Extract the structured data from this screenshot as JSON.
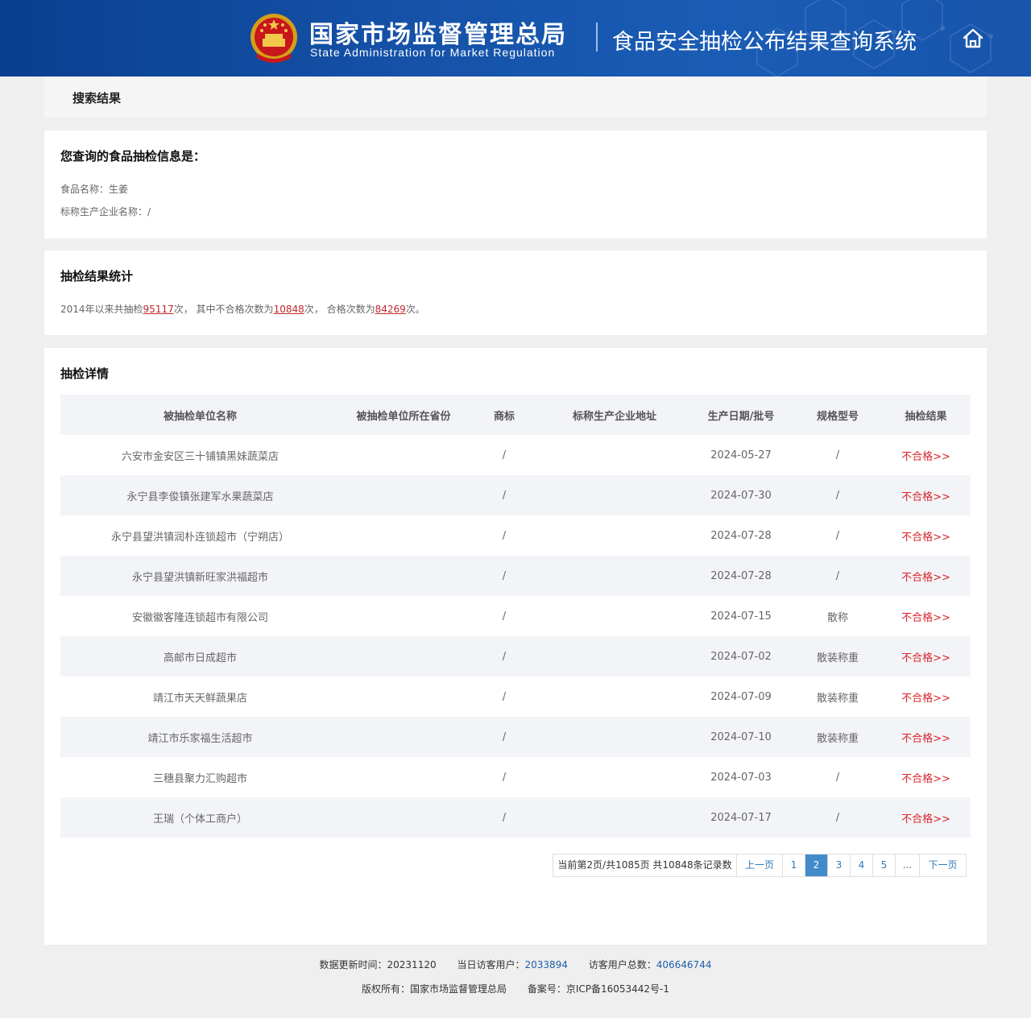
{
  "header": {
    "brand_cn": "国家市场监督管理总局",
    "brand_en": "State Administration  for  Market Regulation",
    "system_title": "食品安全抽检公布结果查询系统",
    "home_icon": "home-icon",
    "bg_color": "#1552a8"
  },
  "crumb": {
    "title": "搜索结果"
  },
  "query": {
    "title": "您查询的食品抽检信息是：",
    "food_name": "食品名称：生姜",
    "producer": "标称生产企业名称：/"
  },
  "stats": {
    "title": "抽检结果统计",
    "prefix": "2014年以来共抽检",
    "total": "95117",
    "mid1": "次， 其中不合格次数为",
    "failed": "10848",
    "mid2": "次， 合格次数为",
    "passed": "84269",
    "suffix": "次。",
    "accent_color": "#c0282d"
  },
  "detail": {
    "title": "抽检详情",
    "columns": [
      "被抽检单位名称",
      "被抽检单位所在省份",
      "商标",
      "标称生产企业地址",
      "生产日期/批号",
      "规格型号",
      "抽检结果"
    ],
    "rows": [
      {
        "unit": "六安市金安区三十铺镇黑妹蔬菜店",
        "province": "",
        "brand": "/",
        "address": "",
        "date": "2024-05-27",
        "spec": "/",
        "result": "不合格>>"
      },
      {
        "unit": "永宁县李俊镇张建军水果蔬菜店",
        "province": "",
        "brand": "/",
        "address": "",
        "date": "2024-07-30",
        "spec": "/",
        "result": "不合格>>"
      },
      {
        "unit": "永宁县望洪镇润朴连锁超市（宁朔店）",
        "province": "",
        "brand": "/",
        "address": "",
        "date": "2024-07-28",
        "spec": "/",
        "result": "不合格>>"
      },
      {
        "unit": "永宁县望洪镇新旺家洪福超市",
        "province": "",
        "brand": "/",
        "address": "",
        "date": "2024-07-28",
        "spec": "/",
        "result": "不合格>>"
      },
      {
        "unit": "安徽徽客隆连锁超市有限公司",
        "province": "",
        "brand": "/",
        "address": "",
        "date": "2024-07-15",
        "spec": "散称",
        "result": "不合格>>"
      },
      {
        "unit": "高邮市日成超市",
        "province": "",
        "brand": "/",
        "address": "",
        "date": "2024-07-02",
        "spec": "散装称重",
        "result": "不合格>>"
      },
      {
        "unit": "靖江市天天鲜蔬果店",
        "province": "",
        "brand": "/",
        "address": "",
        "date": "2024-07-09",
        "spec": "散装称重",
        "result": "不合格>>"
      },
      {
        "unit": "靖江市乐家福生活超市",
        "province": "",
        "brand": "/",
        "address": "",
        "date": "2024-07-10",
        "spec": "散装称重",
        "result": "不合格>>"
      },
      {
        "unit": "三穗县聚力汇购超市",
        "province": "",
        "brand": "/",
        "address": "",
        "date": "2024-07-03",
        "spec": "/",
        "result": "不合格>>"
      },
      {
        "unit": "王瑞（个体工商户）",
        "province": "",
        "brand": "/",
        "address": "",
        "date": "2024-07-17",
        "spec": "/",
        "result": "不合格>>"
      }
    ],
    "result_color": "#d9232a"
  },
  "pager": {
    "info": "当前第2页/共1085页 共10848条记录数",
    "prev": "上一页",
    "pages": [
      "1",
      "2",
      "3",
      "4",
      "5"
    ],
    "current": "2",
    "ellipsis": "...",
    "next": "下一页"
  },
  "footer": {
    "update_label": "数据更新时间：20231120",
    "today_label": "当日访客用户：",
    "today_value": "2033894",
    "total_label": "访客用户总数：",
    "total_value": "406646744",
    "copyright": "版权所有：国家市场监督管理总局",
    "icp": "备案号：京ICP备16053442号-1"
  }
}
